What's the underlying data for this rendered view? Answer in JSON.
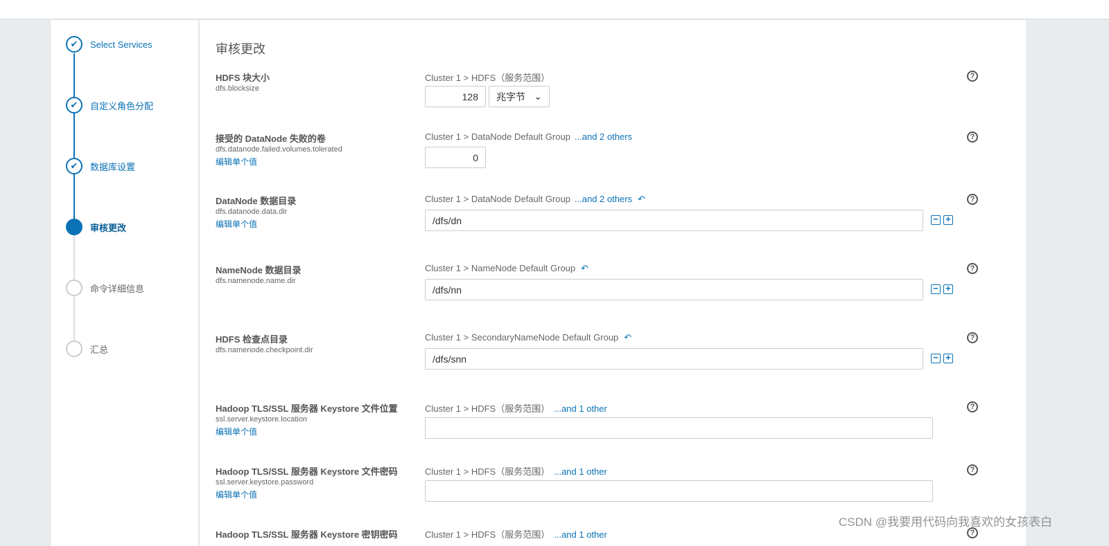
{
  "steps": [
    {
      "label": "Select Services",
      "state": "done"
    },
    {
      "label": "自定义角色分配",
      "state": "done"
    },
    {
      "label": "数据库设置",
      "state": "done"
    },
    {
      "label": "审核更改",
      "state": "active"
    },
    {
      "label": "命令详细信息",
      "state": "todo"
    },
    {
      "label": "汇总",
      "state": "todo"
    }
  ],
  "page_title": "审核更改",
  "edit_label": "编辑单个值",
  "rows": [
    {
      "name": "HDFS 块大小",
      "key": "dfs.blocksize",
      "scope": "Cluster 1 > HDFS（服务范围）",
      "value": "128",
      "unit": "兆字节"
    },
    {
      "name": "接受的 DataNode 失败的卷",
      "key": "dfs.datanode.failed.volumes.tolerated",
      "scope": "Cluster 1 > DataNode Default Group",
      "more": "...and 2 others",
      "value": "0"
    },
    {
      "name": "DataNode 数据目录",
      "key": "dfs.datanode.data.dir",
      "scope": "Cluster 1 > DataNode Default Group",
      "more": "...and 2 others",
      "value": "/dfs/dn"
    },
    {
      "name": "NameNode 数据目录",
      "key": "dfs.namenode.name.dir",
      "scope": "Cluster 1 > NameNode Default Group",
      "value": "/dfs/nn"
    },
    {
      "name": "HDFS 检查点目录",
      "key": "dfs.namenode.checkpoint.dir",
      "scope": "Cluster 1 > SecondaryNameNode Default Group",
      "value": "/dfs/snn"
    },
    {
      "name": "Hadoop TLS/SSL 服务器 Keystore 文件位置",
      "key": "ssl.server.keystore.location",
      "scope": "Cluster 1 > HDFS（服务范围）",
      "more": "...and 1 other",
      "value": ""
    },
    {
      "name": "Hadoop TLS/SSL 服务器 Keystore 文件密码",
      "key": "ssl.server.keystore.password",
      "scope": "Cluster 1 > HDFS（服务范围）",
      "more": "...and 1 other",
      "value": ""
    },
    {
      "name": "Hadoop TLS/SSL 服务器 Keystore 密钥密码",
      "scope": "Cluster 1 > HDFS（服务范围）",
      "more": "...and 1 other"
    }
  ],
  "watermark": "CSDN @我要用代码向我喜欢的女孩表白"
}
